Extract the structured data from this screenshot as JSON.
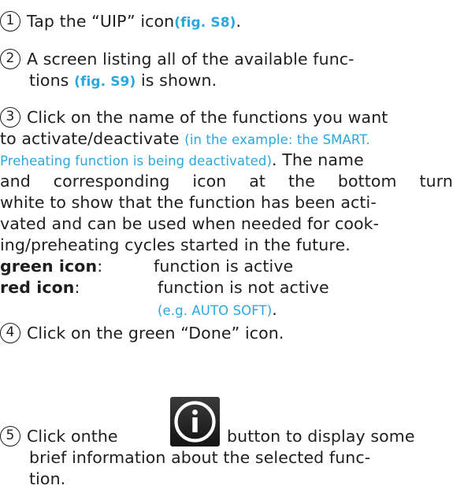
{
  "steps": {
    "s1": {
      "num": "1",
      "text": "Tap the “UIP” icon",
      "fig": "(fig. S8)",
      "end": "."
    },
    "s2": {
      "num": "2",
      "line1": "A screen listing all of the available func-",
      "line2_pre": "tions ",
      "fig": "(fig. S9)",
      "line2_post": " is shown."
    },
    "s3": {
      "num": "3",
      "line1": "Click on the name of the functions you want",
      "line2_pre": "to activate/deactivate ",
      "note_a": "(in the example: the SMART.",
      "note_b": "Preheating function is being deactivated)",
      "line3_post": ". The name",
      "line4": "and corresponding icon at the bottom turn",
      "line5": "white to show that the function has been acti-",
      "line6": "vated and can be used when needed for cook-",
      "line7": "ing/preheating cycles started in the future."
    },
    "legend": {
      "green_label": "green icon",
      "green_colon": ":",
      "green_desc": "function is active",
      "red_label": "red icon",
      "red_colon": ":",
      "red_desc": "function is not active",
      "example": "(e.g. AUTO SOFT)",
      "example_end": "."
    },
    "s4": {
      "num": "4",
      "text": "Click on the green “Done” icon."
    },
    "s5": {
      "num": "5",
      "pre": "Click onthe",
      "post": "button to display some",
      "line2": "brief information about the selected func-",
      "line3": "tion."
    }
  },
  "icons": {
    "info": "info-icon"
  },
  "colors": {
    "accent": "#29a8e0",
    "text": "#1e1e1e"
  }
}
